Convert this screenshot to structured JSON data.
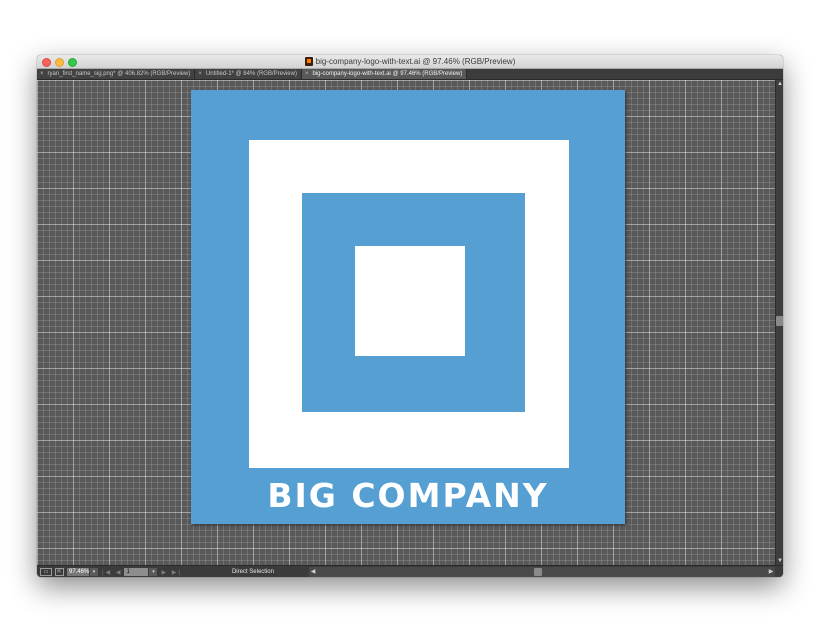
{
  "window": {
    "title": "big-company-logo-with-text.ai @ 97.46% (RGB/Preview)",
    "traffic_lights": [
      "close",
      "minimize",
      "zoom"
    ]
  },
  "tabs": [
    {
      "label": "ryan_first_name_sig.png* @ 406.82% (RGB/Preview)",
      "close": "×",
      "active": false
    },
    {
      "label": "Untitled-1* @ 84% (RGB/Preview)",
      "close": "×",
      "active": false
    },
    {
      "label": "big-company-logo-with-text.ai @ 97.46% (RGB/Preview)",
      "close": "×",
      "active": true
    }
  ],
  "artboard": {
    "logo_text": "BIG COMPANY",
    "colors": {
      "brand_blue": "#569fd2",
      "white": "#ffffff"
    }
  },
  "statusbar": {
    "zoom": "97.46%",
    "zoom_dropdown": "▾",
    "nav_prev": "|◀ ◀",
    "page": "1",
    "page_dropdown": "▾",
    "nav_next": "▶ ▶|",
    "status": "Direct Selection",
    "status_menu": "▶",
    "scroll_left": "◀",
    "scroll_right": "▶"
  },
  "scrollbar": {
    "up": "▲",
    "down": "▼"
  },
  "icons": [
    "document-icon",
    "artboard-icon",
    "share-icon"
  ]
}
